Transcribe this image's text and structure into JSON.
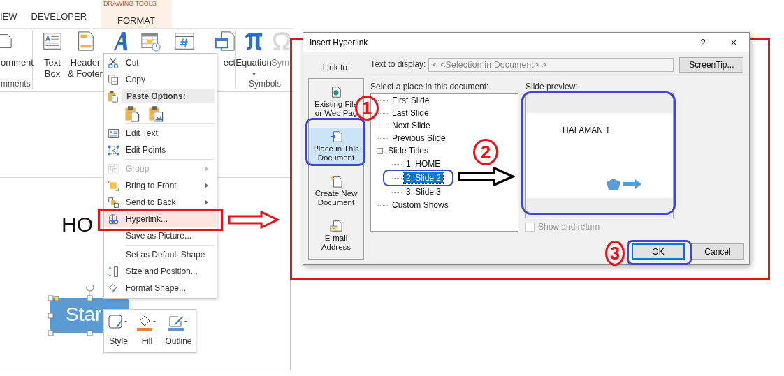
{
  "ribbon": {
    "contextual_label": "DRAWING TOOLS",
    "tabs": [
      {
        "label": "IEW",
        "contextual": false
      },
      {
        "label": "DEVELOPER",
        "contextual": false
      },
      {
        "label": "FORMAT",
        "contextual": true
      }
    ],
    "groups": [
      {
        "label": "mments",
        "buttons": [
          {
            "label": "omment",
            "disabled": false,
            "dropdown": false
          }
        ]
      },
      {
        "buttons": [
          {
            "label": "Text\nBox",
            "disabled": false
          },
          {
            "label": "Header\n& Footer",
            "disabled": false
          },
          {
            "disabled": false
          },
          {
            "disabled": false
          },
          {
            "disabled": false
          },
          {
            "label": "ect",
            "disabled": false
          }
        ]
      },
      {
        "label": "Symbols",
        "buttons": [
          {
            "label": "Equation",
            "disabled": false,
            "dropdown": true
          },
          {
            "label": "Sym",
            "disabled": true,
            "dropdown": false
          }
        ]
      }
    ]
  },
  "slide": {
    "title": "HO",
    "shape_text": "Star"
  },
  "context_menu": {
    "items": [
      {
        "kind": "item",
        "label": "Cut",
        "disabled": false,
        "submenu": false,
        "highlighted": false
      },
      {
        "kind": "item",
        "label": "Copy",
        "disabled": false,
        "submenu": false,
        "highlighted": false
      },
      {
        "kind": "header",
        "label": "Paste Options:"
      },
      {
        "kind": "paste_icons"
      },
      {
        "kind": "separator"
      },
      {
        "kind": "item",
        "label": "Edit Text",
        "disabled": false,
        "submenu": false,
        "highlighted": false
      },
      {
        "kind": "item",
        "label": "Edit Points",
        "disabled": false,
        "submenu": false,
        "highlighted": false
      },
      {
        "kind": "separator"
      },
      {
        "kind": "item",
        "label": "Group",
        "disabled": true,
        "submenu": true,
        "highlighted": false
      },
      {
        "kind": "item",
        "label": "Bring to Front",
        "disabled": false,
        "submenu": true,
        "highlighted": false
      },
      {
        "kind": "item",
        "label": "Send to Back",
        "disabled": false,
        "submenu": true,
        "highlighted": false
      },
      {
        "kind": "item",
        "label": "Hyperlink...",
        "disabled": false,
        "submenu": false,
        "highlighted": true
      },
      {
        "kind": "item",
        "label": "Save as Picture...",
        "disabled": false,
        "submenu": false,
        "highlighted": false
      },
      {
        "kind": "separator"
      },
      {
        "kind": "item",
        "label": "Set as Default Shape",
        "disabled": false,
        "submenu": false,
        "highlighted": false
      },
      {
        "kind": "item",
        "label": "Size and Position...",
        "disabled": false,
        "submenu": false,
        "highlighted": false
      },
      {
        "kind": "item",
        "label": "Format Shape...",
        "disabled": false,
        "submenu": false,
        "highlighted": false
      }
    ]
  },
  "mini_toolbar": {
    "buttons": [
      {
        "label": "Style"
      },
      {
        "label": "Fill"
      },
      {
        "label": "Outline"
      }
    ]
  },
  "dialog": {
    "title": "Insert Hyperlink",
    "help": "?",
    "close": "×",
    "link_to_label": "Link to:",
    "link_to": [
      {
        "label": "Existing File\nor Web Pag",
        "selected": false
      },
      {
        "label": "Place in This\nDocument",
        "selected": true
      },
      {
        "label": "Create New\nDocument",
        "selected": false
      },
      {
        "label": "E-mail\nAddress",
        "selected": false
      }
    ],
    "text_to_display": {
      "label": "Text to display:",
      "value": "< <Selection in Document> >"
    },
    "screentip": "ScreenTip...",
    "place_label": "Select a place in this document:",
    "tree": [
      {
        "label": "First Slide",
        "selected": false
      },
      {
        "label": "Last Slide",
        "selected": false
      },
      {
        "label": "Next Slide",
        "selected": false
      },
      {
        "label": "Previous Slide",
        "selected": false
      },
      {
        "label": "Slide Titles",
        "selected": false,
        "expanded": true,
        "children": [
          {
            "label": "1. HOME",
            "selected": false
          },
          {
            "label": "2. Slide 2",
            "selected": true
          },
          {
            "label": "3. Slide 3",
            "selected": false
          }
        ]
      },
      {
        "label": "Custom Shows",
        "selected": false
      }
    ],
    "preview_label": "Slide preview:",
    "preview_title": "HALAMAN 1",
    "show_and_return": {
      "label": "Show and return",
      "checked": false,
      "disabled": true
    },
    "buttons": [
      {
        "label": "OK",
        "default": true
      },
      {
        "label": "Cancel",
        "default": false
      }
    ]
  },
  "annotations": {
    "steps": [
      "1",
      "2",
      "3"
    ]
  }
}
